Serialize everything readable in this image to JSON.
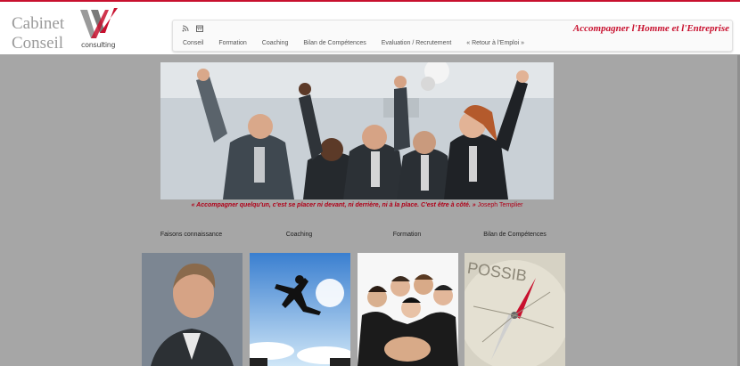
{
  "brand": {
    "line1": "Cabinet",
    "line2": "Conseil",
    "logo_text": "consulting"
  },
  "icons": [
    "rss-icon",
    "calendar-icon"
  ],
  "nav": [
    {
      "label": "Conseil"
    },
    {
      "label": "Formation"
    },
    {
      "label": "Coaching"
    },
    {
      "label": "Bilan de Compétences"
    },
    {
      "label": "Evaluation / Recrutement"
    },
    {
      "label": "« Retour à l'Emploi »"
    }
  ],
  "tagline": "Accompagner l'Homme et l'Entreprise",
  "quote": {
    "text": "« Accompagner quelqu'un, c'est se placer ni devant, ni derrière, ni à la place. C'est être à côté. »",
    "author": "Joseph Templier"
  },
  "tiles": [
    {
      "title": "Faisons connaissance"
    },
    {
      "title": "Coaching"
    },
    {
      "title": "Formation"
    },
    {
      "title": "Bilan de Compétences"
    }
  ],
  "colors": {
    "accent": "#c8102e",
    "background": "#a6a6a6"
  }
}
